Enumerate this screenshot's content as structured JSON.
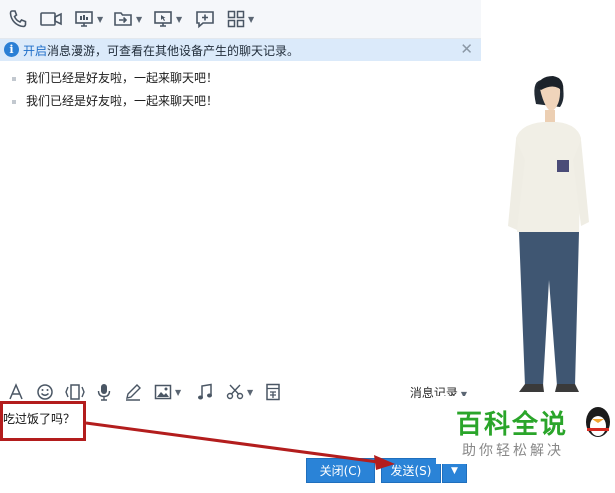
{
  "info_bar": {
    "link_text": "开启",
    "text": "消息漫游，可查看在其他设备产生的聊天记录。"
  },
  "messages": [
    {
      "text": "我们已经是好友啦，一起来聊天吧！"
    },
    {
      "text": "我们已经是好友啦，一起来聊天吧！"
    }
  ],
  "input_toolbar": {
    "history_label": "消息记录"
  },
  "input": {
    "value": "吃过饭了吗？"
  },
  "footer": {
    "close_label": "关闭(C)",
    "send_label": "发送(S)"
  },
  "watermark": {
    "title": "百科全说",
    "subtitle": "助你轻松解决"
  },
  "colors": {
    "accent": "#2a83d7",
    "highlight": "#b31d1d",
    "info_bg": "#dbeafa",
    "watermark_green": "#2aa52a"
  }
}
